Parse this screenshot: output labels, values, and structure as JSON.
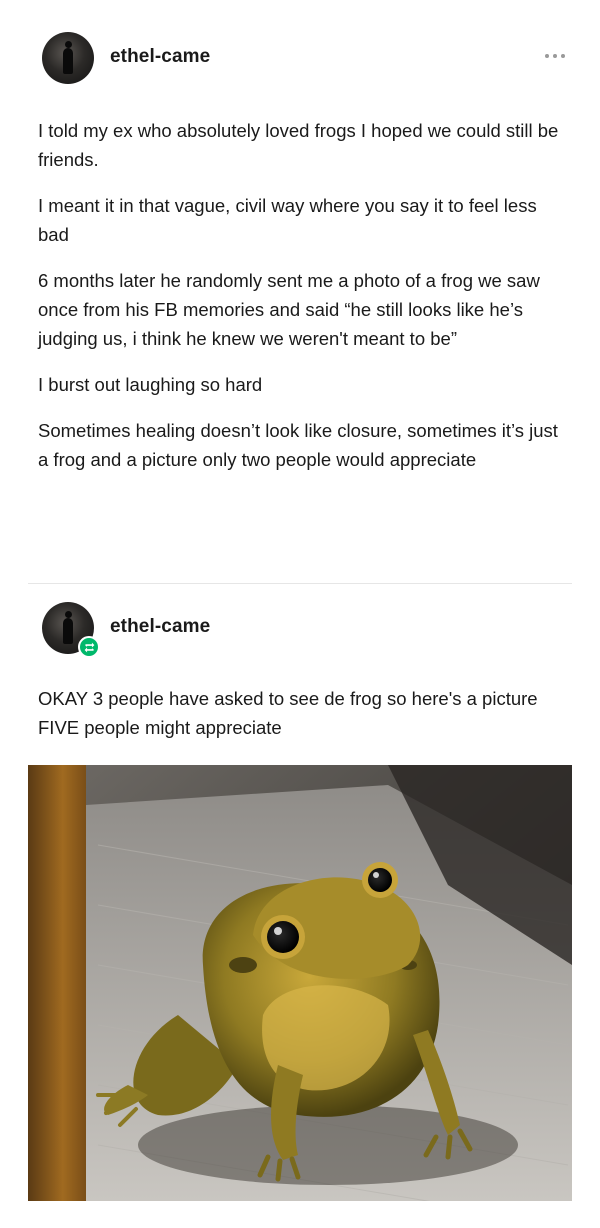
{
  "posts": [
    {
      "username": "ethel-came",
      "paragraphs": [
        "I told my ex who absolutely loved frogs I hoped we could still be friends.",
        "I meant it in that vague, civil way where you say it to feel less bad",
        "6 months later he randomly sent me a photo of a frog we saw once from his FB memories and said “he still looks like he’s judging us, i think he knew we weren't meant to be”",
        "I burst out laughing so hard",
        "Sometimes healing doesn’t look like closure, sometimes it’s just a frog and a picture only two people would appreciate"
      ],
      "more_icon": "ellipsis-icon"
    },
    {
      "username": "ethel-came",
      "reblog_icon": "reblog-icon",
      "reblog_color": "#00b86b",
      "paragraphs": [
        "OKAY 3 people have asked to see de frog so here's a picture FIVE people might appreciate"
      ],
      "image": "frog-photo"
    }
  ]
}
